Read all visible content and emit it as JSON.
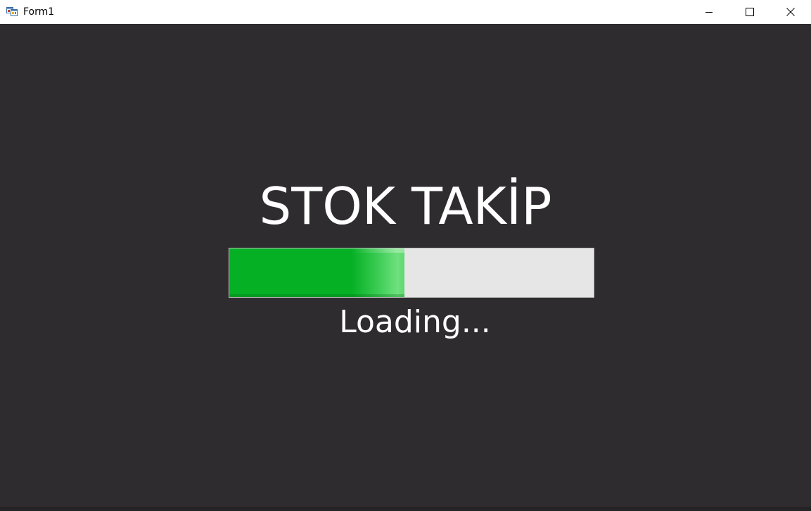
{
  "window": {
    "title": "Form1",
    "icon": "winforms-app-icon",
    "controls": {
      "minimize_icon": "minimize-icon",
      "maximize_icon": "maximize-icon",
      "close_icon": "close-icon"
    }
  },
  "main": {
    "title": "STOK TAKİP",
    "loading_text": "Loading...",
    "progress": {
      "value_percent": 48,
      "fill_color": "#06b025",
      "track_color": "#e6e6e6"
    }
  },
  "colors": {
    "background": "#2e2c2f",
    "titlebar": "#ffffff",
    "text": "#ffffff"
  }
}
